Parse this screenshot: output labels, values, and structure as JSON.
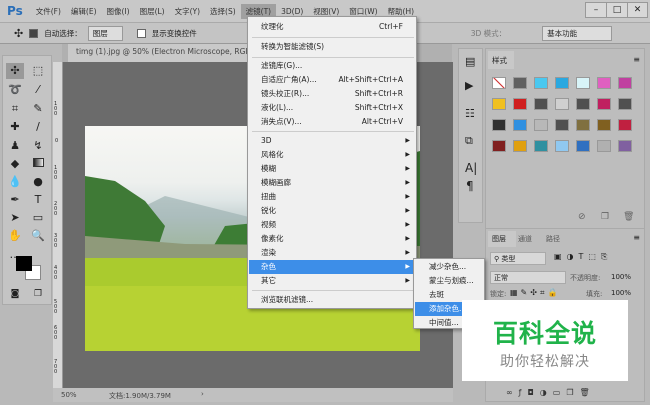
{
  "menubar": {
    "logo": "Ps",
    "items": [
      "文件(F)",
      "编辑(E)",
      "图像(I)",
      "图层(L)",
      "文字(Y)",
      "选择(S)",
      "滤镜(T)",
      "3D(D)",
      "视图(V)",
      "窗口(W)",
      "帮助(H)"
    ],
    "active_index": 6,
    "window_buttons": [
      "–",
      "□",
      "✕"
    ]
  },
  "options": {
    "auto_select_label": "自动选择：",
    "auto_select_value": "图层",
    "show_transform_label": "显示变换控件",
    "mode3d_label": "3D 模式：",
    "workspace": "基本功能"
  },
  "document": {
    "tab_title": "timg (1).jpg @ 50% (Electron Microscope, RGB/8#) *",
    "zoom": "50%",
    "doc_info": "文档:1.90M/3.79M"
  },
  "ruler_ticks": [
    "1 0 0",
    "0",
    "1 0 0",
    "2 0 0",
    "3 0 0",
    "4 0 0",
    "5 0 0",
    "6 0 0",
    "7 0 0"
  ],
  "filter_menu": {
    "top": [
      {
        "label": "纹理化",
        "shortcut": "Ctrl+F"
      }
    ],
    "convert": {
      "label": "转换为智能滤镜(S)"
    },
    "group1": [
      {
        "label": "滤镜库(G)...",
        "shortcut": ""
      },
      {
        "label": "自适应广角(A)...",
        "shortcut": "Alt+Shift+Ctrl+A"
      },
      {
        "label": "镜头校正(R)...",
        "shortcut": "Shift+Ctrl+R"
      },
      {
        "label": "液化(L)...",
        "shortcut": "Shift+Ctrl+X"
      },
      {
        "label": "消失点(V)...",
        "shortcut": "Alt+Ctrl+V"
      }
    ],
    "submenus": [
      "3D",
      "风格化",
      "模糊",
      "模糊画廊",
      "扭曲",
      "锐化",
      "视频",
      "像素化",
      "渲染",
      "杂色",
      "其它"
    ],
    "highlighted": "杂色",
    "browse": "浏览联机滤镜..."
  },
  "noise_submenu": {
    "items": [
      "减少杂色...",
      "蒙尘与划痕...",
      "去斑",
      "添加杂色...",
      "中间值..."
    ],
    "highlighted": "添加杂色..."
  },
  "styles_panel": {
    "tab": "样式",
    "swatch_colors": [
      "#ffffff",
      "#606060",
      "#4ac8f0",
      "#2aa8e0",
      "#d8f4f8",
      "#e060c0",
      "#c040a0",
      "#f0c020",
      "#d02020",
      "#505050",
      "#d0d0d0",
      "#505050",
      "#c02060",
      "#505050",
      "#303030",
      "#3090e0",
      "#b8b8b8",
      "#505050",
      "#807040",
      "#806020",
      "#c02040",
      "#802020",
      "#e0a010",
      "#3090a0",
      "#90c8f0",
      "#3070c0",
      "#b0b0b0",
      "#8060a0"
    ]
  },
  "layers_panel": {
    "tabs": [
      "图层",
      "通道",
      "路径"
    ],
    "filter_kind": "类型",
    "blend_mode": "正常",
    "opacity_label": "不透明度:",
    "opacity": "100%",
    "lock_label": "锁定:",
    "fill_label": "填充:",
    "fill": "100%"
  },
  "watermark": {
    "title": "百科全说",
    "subtitle": "助你轻松解决"
  }
}
